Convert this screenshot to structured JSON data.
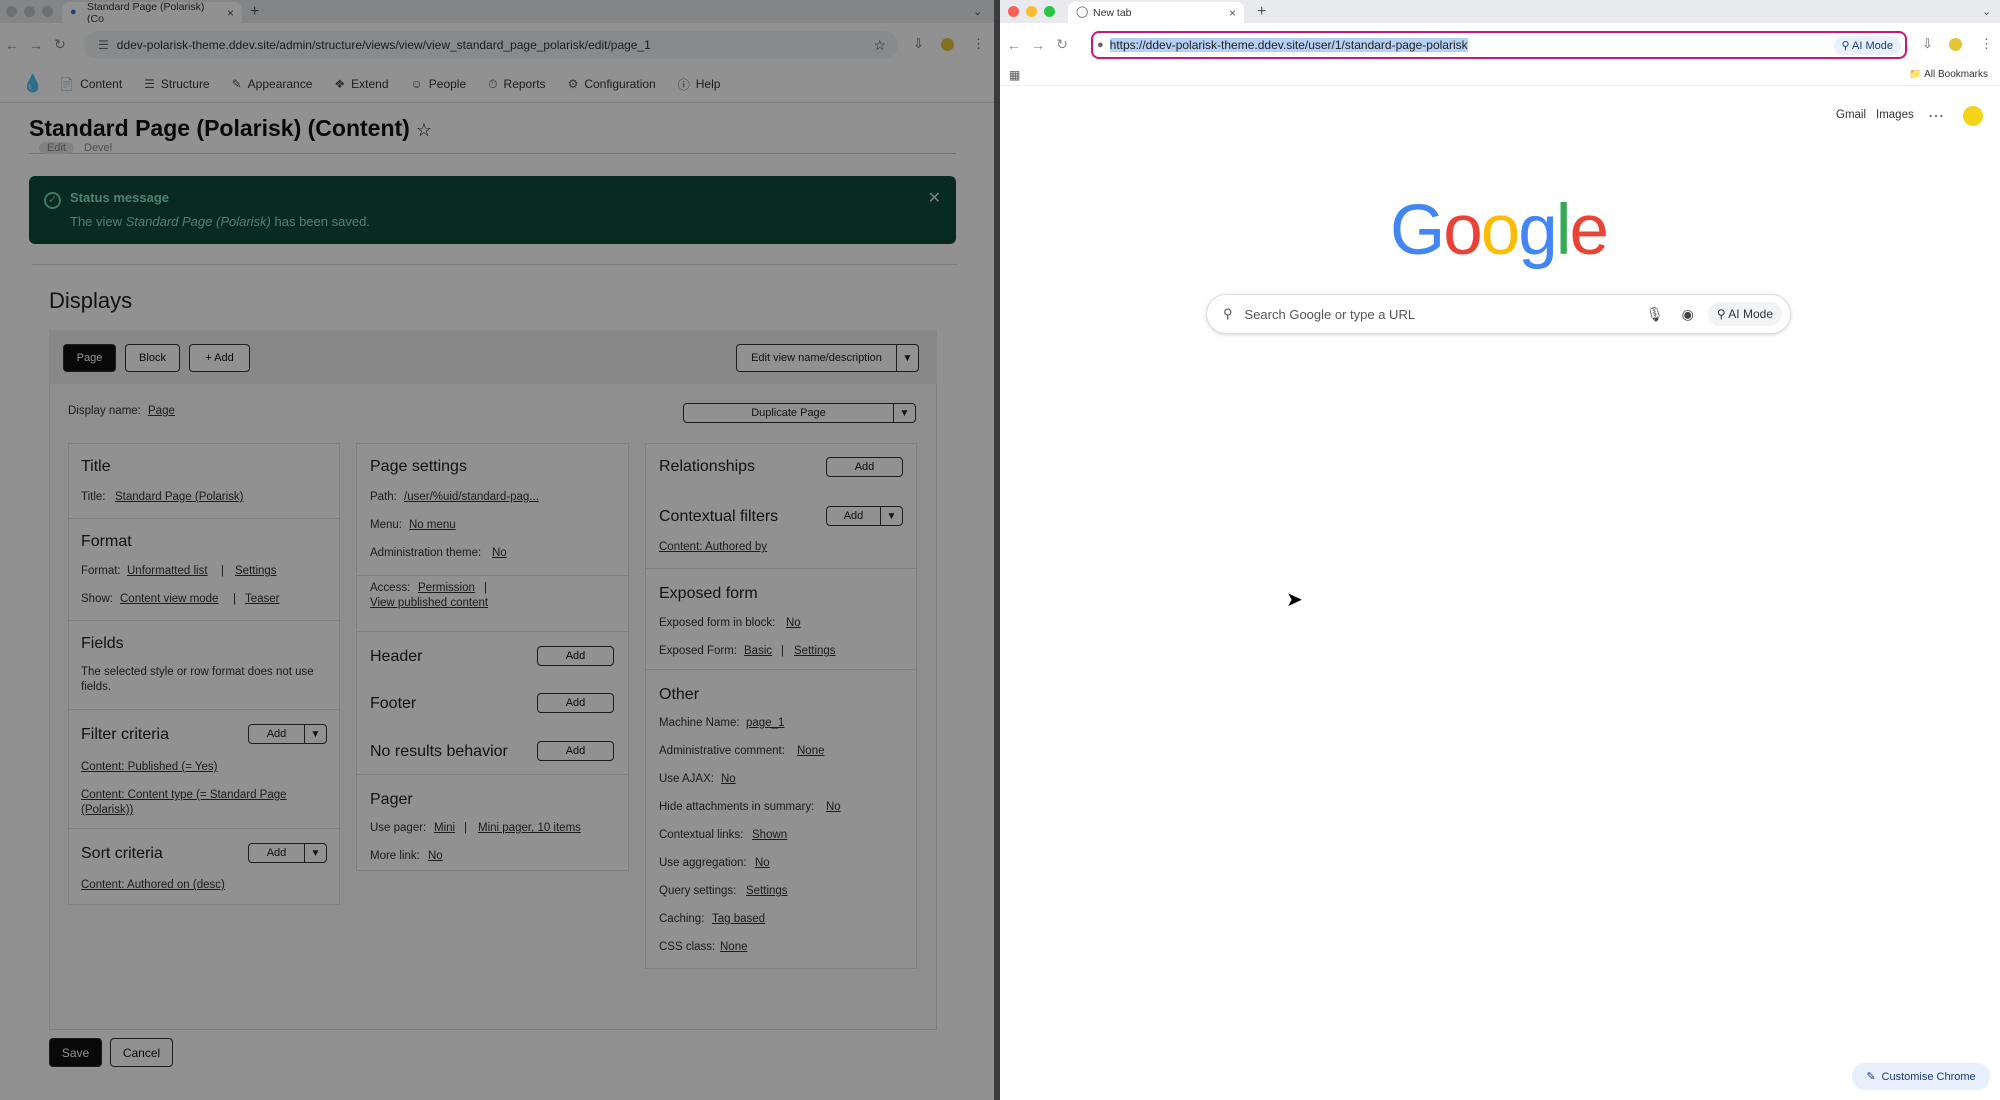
{
  "left_window": {
    "tab_title": "Standard Page (Polarisk) (Co",
    "url": "ddev-polarisk-theme.ddev.site/admin/structure/views/view/view_standard_page_polarisk/edit/page_1",
    "toolbar_menu": [
      "Content",
      "Structure",
      "Appearance",
      "Extend",
      "People",
      "Reports",
      "Configuration",
      "Help"
    ],
    "page_title": "Standard Page (Polarisk) (Content)",
    "hidden_tabs": [
      "Edit",
      "Devel"
    ],
    "status": {
      "heading": "Status message",
      "prefix": "The view ",
      "view_name": "Standard Page (Polarisk)",
      "suffix": " has been saved."
    },
    "displays_heading": "Displays",
    "display_tabs": {
      "page": "Page",
      "block": "Block",
      "add": "+ Add"
    },
    "edit_view_label": "Edit view name/description",
    "display_name_label": "Display name:",
    "display_name_value": "Page",
    "duplicate_label": "Duplicate Page",
    "col1": {
      "title_h": "Title",
      "title_label": "Title:",
      "title_value": "Standard Page (Polarisk)",
      "format_h": "Format",
      "format_label": "Format:",
      "format_value": "Unformatted list",
      "format_settings": "Settings",
      "show_label": "Show:",
      "show_value": "Content view mode",
      "show_teaser": "Teaser",
      "fields_h": "Fields",
      "fields_text_1": "The selected style or row format does not use",
      "fields_text_2": "fields.",
      "filter_h": "Filter criteria",
      "filter_1": "Content: Published (= Yes)",
      "filter_2a": "Content: Content type (= Standard Page",
      "filter_2b": "(Polarisk))",
      "sort_h": "Sort criteria",
      "sort_1": "Content: Authored on (desc)",
      "add": "Add"
    },
    "col2": {
      "page_settings_h": "Page settings",
      "path_label": "Path:",
      "path_value": "/user/%uid/standard-pag...",
      "menu_label": "Menu:",
      "menu_value": "No menu",
      "admin_theme_label": "Administration theme:",
      "admin_theme_value": "No",
      "access_label": "Access:",
      "access_value": "Permission",
      "access_perm": "View published content",
      "header_h": "Header",
      "footer_h": "Footer",
      "no_results_h": "No results behavior",
      "pager_h": "Pager",
      "use_pager_label": "Use pager:",
      "use_pager_value": "Mini",
      "use_pager_detail": "Mini pager, 10 items",
      "more_link_label": "More link:",
      "more_link_value": "No",
      "add": "Add"
    },
    "col3": {
      "relationships_h": "Relationships",
      "contextual_h": "Contextual filters",
      "contextual_1": "Content: Authored by",
      "exposed_h": "Exposed form",
      "exposed_block_label": "Exposed form in block:",
      "exposed_block_value": "No",
      "exposed_form_label": "Exposed Form:",
      "exposed_form_value": "Basic",
      "exposed_form_settings": "Settings",
      "other_h": "Other",
      "machine_label": "Machine Name:",
      "machine_value": "page_1",
      "admin_comment_label": "Administrative comment:",
      "admin_comment_value": "None",
      "ajax_label": "Use AJAX:",
      "ajax_value": "No",
      "hide_attach_label": "Hide attachments in summary:",
      "hide_attach_value": "No",
      "ctx_links_label": "Contextual links:",
      "ctx_links_value": "Shown",
      "aggregation_label": "Use aggregation:",
      "aggregation_value": "No",
      "query_label": "Query settings:",
      "query_value": "Settings",
      "caching_label": "Caching:",
      "caching_value": "Tag based",
      "css_label": "CSS class:",
      "css_value": "None",
      "add": "Add"
    },
    "save": "Save",
    "cancel": "Cancel"
  },
  "right_window": {
    "tab_title": "New tab",
    "url": "https://ddev-polarisk-theme.ddev.site/user/1/standard-page-polarisk",
    "ai_mode": "AI Mode",
    "all_bookmarks": "All Bookmarks",
    "gmail": "Gmail",
    "images": "Images",
    "logo": [
      "G",
      "o",
      "o",
      "g",
      "l",
      "e"
    ],
    "logo_colors": [
      "#4285F4",
      "#EA4335",
      "#FBBC05",
      "#4285F4",
      "#34A853",
      "#EA4335"
    ],
    "search_placeholder": "Search Google or type a URL",
    "search_ai_mode": "AI Mode",
    "customise": "Customise Chrome"
  },
  "colors": {
    "status_bg": "#0f4a3b",
    "url_highlight": "#c7177a",
    "drupal_dark": "#111111"
  }
}
